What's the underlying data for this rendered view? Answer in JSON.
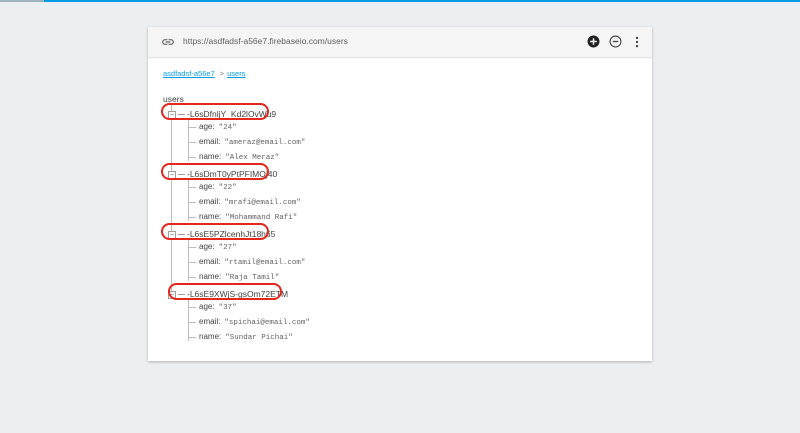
{
  "url": "https://asdfadsf-a56e7.firebaseio.com/users",
  "breadcrumb": {
    "project": "asdfadsf-a56e7",
    "separator": ">",
    "current": "users"
  },
  "root": {
    "label": "users"
  },
  "records": [
    {
      "key": "-L6sDfnljY_Kd2lOvWu9",
      "toggle": "–",
      "fields": [
        {
          "name": "age:",
          "value": "\"24\""
        },
        {
          "name": "email:",
          "value": "\"ameraz@email.com\""
        },
        {
          "name": "name:",
          "value": "\"Alex Meraz\""
        }
      ]
    },
    {
      "key": "-L6sDmT0yPtPFIMOj40",
      "toggle": "–",
      "fields": [
        {
          "name": "age:",
          "value": "\"22\""
        },
        {
          "name": "email:",
          "value": "\"mrafi@email.com\""
        },
        {
          "name": "name:",
          "value": "\"Mohammand Rafi\""
        }
      ]
    },
    {
      "key": "-L6sE5PZlcenhJt18h65",
      "toggle": "–",
      "fields": [
        {
          "name": "age:",
          "value": "\"27\""
        },
        {
          "name": "email:",
          "value": "\"rtamil@email.com\""
        },
        {
          "name": "name:",
          "value": "\"Raja Tamil\""
        }
      ]
    },
    {
      "key": "-L6sE9XWjS-gsOm72ETM",
      "toggle": "–",
      "fields": [
        {
          "name": "age:",
          "value": "\"37\""
        },
        {
          "name": "email:",
          "value": "\"spichai@email.com\""
        },
        {
          "name": "name:",
          "value": "\"Sundar Pichai\""
        }
      ]
    }
  ],
  "icons": {
    "link": "link-icon",
    "add": "add-circle-icon",
    "remove": "remove-circle-icon",
    "more": "more-vert-icon"
  },
  "colors": {
    "accent": "#039be5",
    "annotation": "#e3271d",
    "background": "#eceff1"
  }
}
